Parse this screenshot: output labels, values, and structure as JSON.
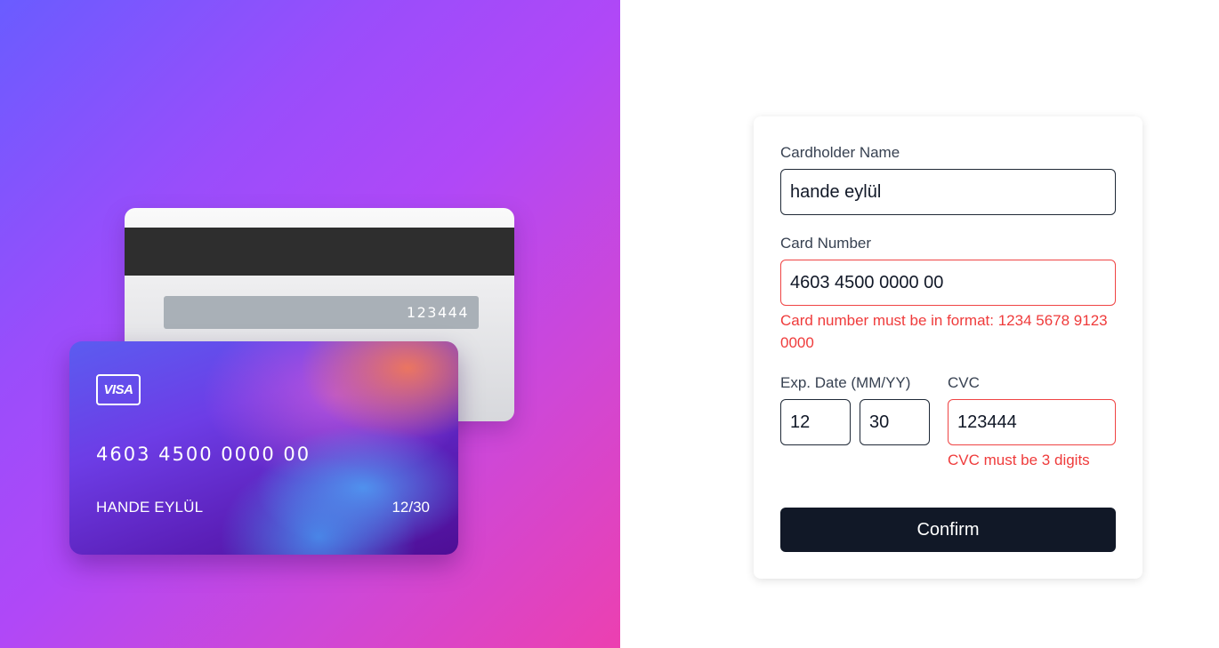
{
  "card_back": {
    "cvc": "123444"
  },
  "card_front": {
    "brand": "VISA",
    "number": "4603 4500 0000 00",
    "holder": "HANDE EYLÜL",
    "expiry": "12/30"
  },
  "form": {
    "name_label": "Cardholder Name",
    "name_value": "hande eylül",
    "number_label": "Card Number",
    "number_value": "4603 4500 0000 00",
    "number_error": "Card number must be in format: 1234 5678 9123 0000",
    "exp_label": "Exp. Date (MM/YY)",
    "exp_month": "12",
    "exp_year": "30",
    "cvc_label": "CVC",
    "cvc_value": "123444",
    "cvc_error": "CVC must be 3 digits",
    "confirm_label": "Confirm"
  },
  "colors": {
    "error": "#ef3b3b",
    "button": "#111827",
    "gradient_start": "#6a5cff",
    "gradient_end": "#ec40b0"
  }
}
